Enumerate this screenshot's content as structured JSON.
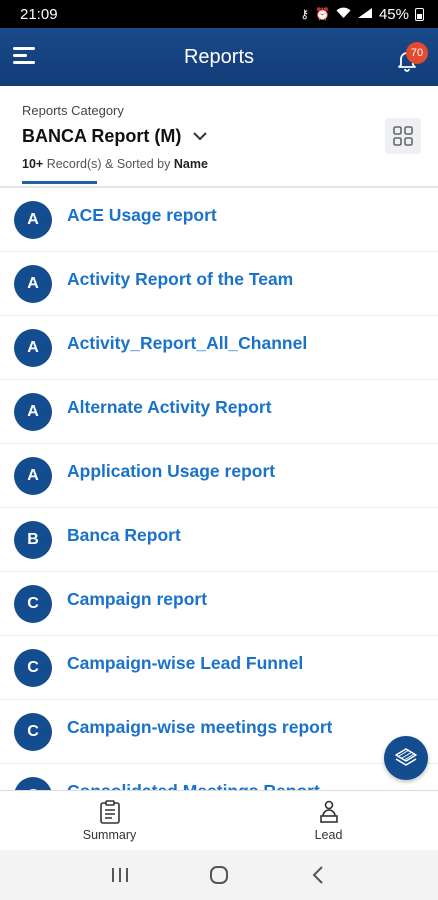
{
  "status_bar": {
    "time": "21:09",
    "battery": "45%"
  },
  "header": {
    "title": "Reports",
    "notification_count": "70",
    "menu_icon": "hamburger-icon",
    "bell_icon": "bell-icon"
  },
  "category": {
    "caption": "Reports Category",
    "selected": "BANCA Report (M)",
    "records_count": "10+",
    "records_text": "Record(s) & Sorted by",
    "sort_field": "Name"
  },
  "reports": [
    {
      "initial": "A",
      "name": "ACE Usage report"
    },
    {
      "initial": "A",
      "name": "Activity Report of the Team"
    },
    {
      "initial": "A",
      "name": "Activity_Report_All_Channel"
    },
    {
      "initial": "A",
      "name": "Alternate Activity Report"
    },
    {
      "initial": "A",
      "name": "Application Usage report"
    },
    {
      "initial": "B",
      "name": "Banca Report"
    },
    {
      "initial": "C",
      "name": "Campaign report"
    },
    {
      "initial": "C",
      "name": "Campaign-wise Lead Funnel"
    },
    {
      "initial": "C",
      "name": "Campaign-wise meetings report"
    },
    {
      "initial": "C",
      "name": "Consolidated Meetings Report"
    }
  ],
  "bottom_nav": {
    "summary_label": "Summary",
    "lead_label": "Lead"
  },
  "colors": {
    "header_bg": "#1b4a8a",
    "accent": "#1a72c9",
    "avatar_bg": "#134c8f",
    "badge": "#e34a2f"
  }
}
